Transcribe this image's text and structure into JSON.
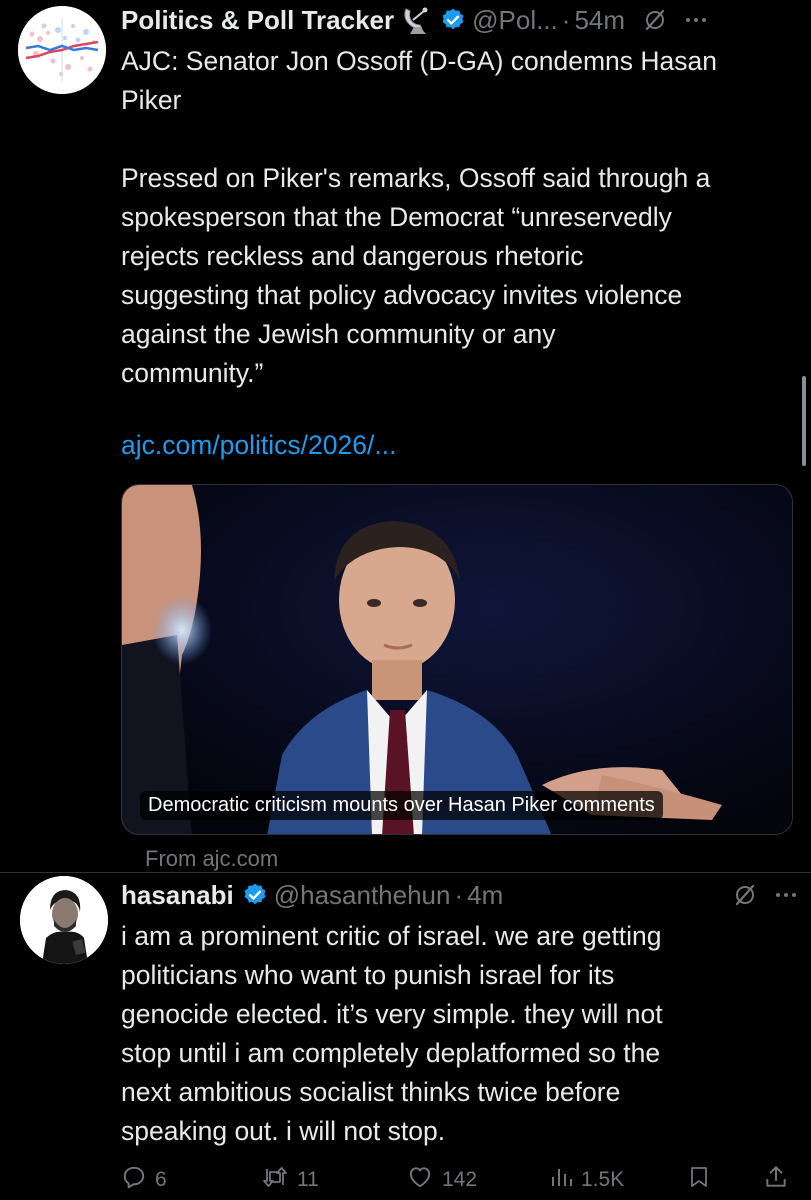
{
  "tweet1": {
    "display_name": "Politics & Poll Tracker",
    "name_emoji": "satellite-antenna-icon",
    "handle": "@Pol...",
    "separator": "·",
    "time": "54m",
    "body_lines": [
      "AJC: Senator Jon Ossoff (D-GA) condemns Hasan",
      "Piker",
      "",
      "Pressed on Piker's remarks, Ossoff said through a",
      "spokesperson that the Democrat “unreservedly",
      "rejects reckless and dangerous rhetoric",
      "suggesting that policy advocacy invites violence",
      "against the Jewish community or any",
      "community.”"
    ],
    "link_text": "ajc.com/politics/2026/...",
    "card": {
      "caption": "Democratic criticism mounts over Hasan Piker comments",
      "source": "From ajc.com"
    }
  },
  "tweet2": {
    "display_name": "hasanabi",
    "handle": "@hasanthehun",
    "separator": "·",
    "time": "4m",
    "body_lines": [
      "i am a prominent critic of israel. we are getting",
      "politicians who want to punish israel for its",
      "genocide elected. it’s very simple. they will not",
      "stop until i am completely deplatformed so the",
      "next ambitious socialist thinks twice before",
      "speaking out. i will not stop."
    ],
    "actions": {
      "replies": "6",
      "reposts": "11",
      "likes": "142",
      "views": "1.5K"
    }
  },
  "colors": {
    "background": "#000000",
    "text": "#e7e9ea",
    "secondary": "#71767b",
    "link": "#1d9bf0",
    "verified": "#1d9bf0",
    "divider": "#2f3336"
  }
}
